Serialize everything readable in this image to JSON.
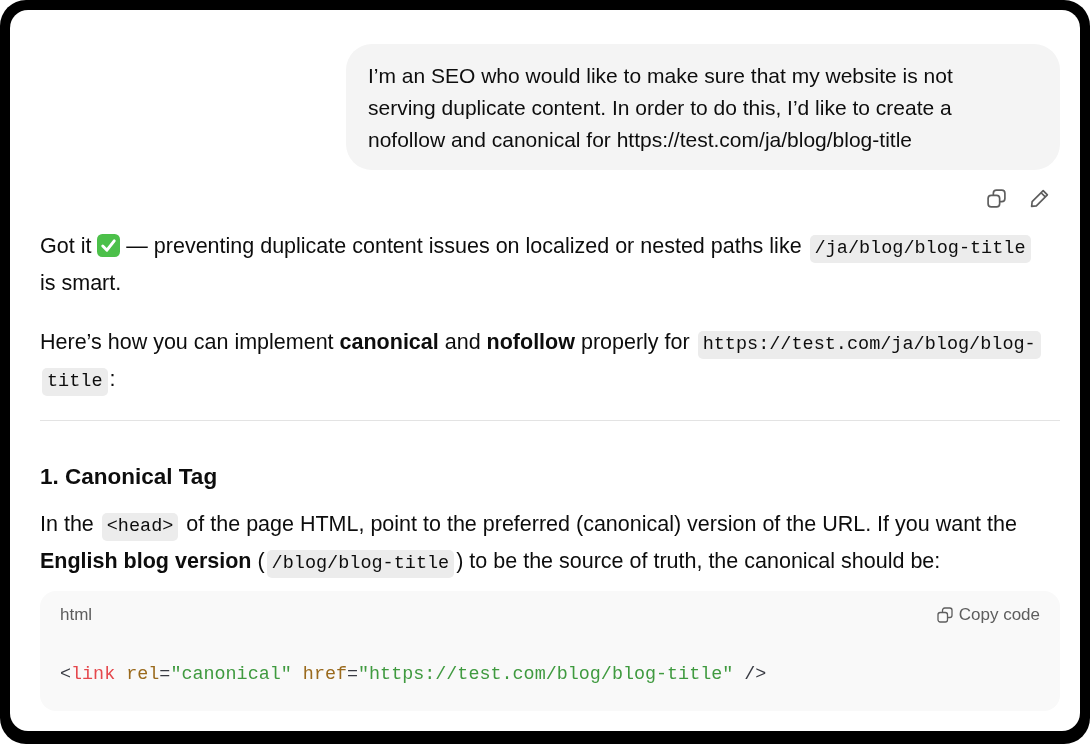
{
  "user_message": {
    "text": "I’m an SEO who would like to make sure that my website is not serving duplicate content. In order to do this, I’d like to create a nofollow and canonical for https://test.com/ja/blog/blog-title"
  },
  "assistant_message": {
    "blocks": [
      {
        "kind": "paragraph",
        "parts": [
          {
            "kind": "text",
            "text": "Got it "
          },
          {
            "kind": "check_emoji"
          },
          {
            "kind": "text",
            "text": " — preventing duplicate content issues on localized or nested paths like "
          },
          {
            "kind": "code",
            "text": "/ja/blog/blog-title"
          },
          {
            "kind": "text",
            "text": " is smart."
          }
        ]
      },
      {
        "kind": "paragraph",
        "parts": [
          {
            "kind": "text",
            "text": "Here’s how you can implement **canonical** and **nofollow** properly for "
          },
          {
            "kind": "code",
            "text": "https://test.com/ja/blog/blog-"
          },
          {
            "kind": "code",
            "text": "title"
          },
          {
            "kind": "text",
            "text": ":"
          }
        ]
      },
      {
        "kind": "divider"
      },
      {
        "kind": "heading",
        "text": "1. Canonical Tag"
      },
      {
        "kind": "paragraph",
        "parts": [
          {
            "kind": "text",
            "text": "In the "
          },
          {
            "kind": "code",
            "text": "<head>"
          },
          {
            "kind": "text",
            "text": " of the page HTML, point to the preferred (canonical) version of the URL. If you want the **English blog version** ("
          },
          {
            "kind": "code",
            "text": "/blog/blog-title"
          },
          {
            "kind": "text",
            "text": ") to be the source of truth, the canonical should be:"
          }
        ]
      },
      {
        "kind": "code_block",
        "language": "html",
        "copy_label": "Copy code",
        "tokens": [
          {
            "kind": "punct",
            "text": "<"
          },
          {
            "kind": "tag",
            "text": "link"
          },
          {
            "kind": "attr",
            "text": " rel"
          },
          {
            "kind": "punct",
            "text": "="
          },
          {
            "kind": "string",
            "text": "\"canonical\""
          },
          {
            "kind": "attr",
            "text": " href"
          },
          {
            "kind": "punct",
            "text": "="
          },
          {
            "kind": "string",
            "text": "\"https://test.com/blog/blog-title\""
          },
          {
            "kind": "punct",
            "text": " />"
          }
        ]
      }
    ]
  }
}
